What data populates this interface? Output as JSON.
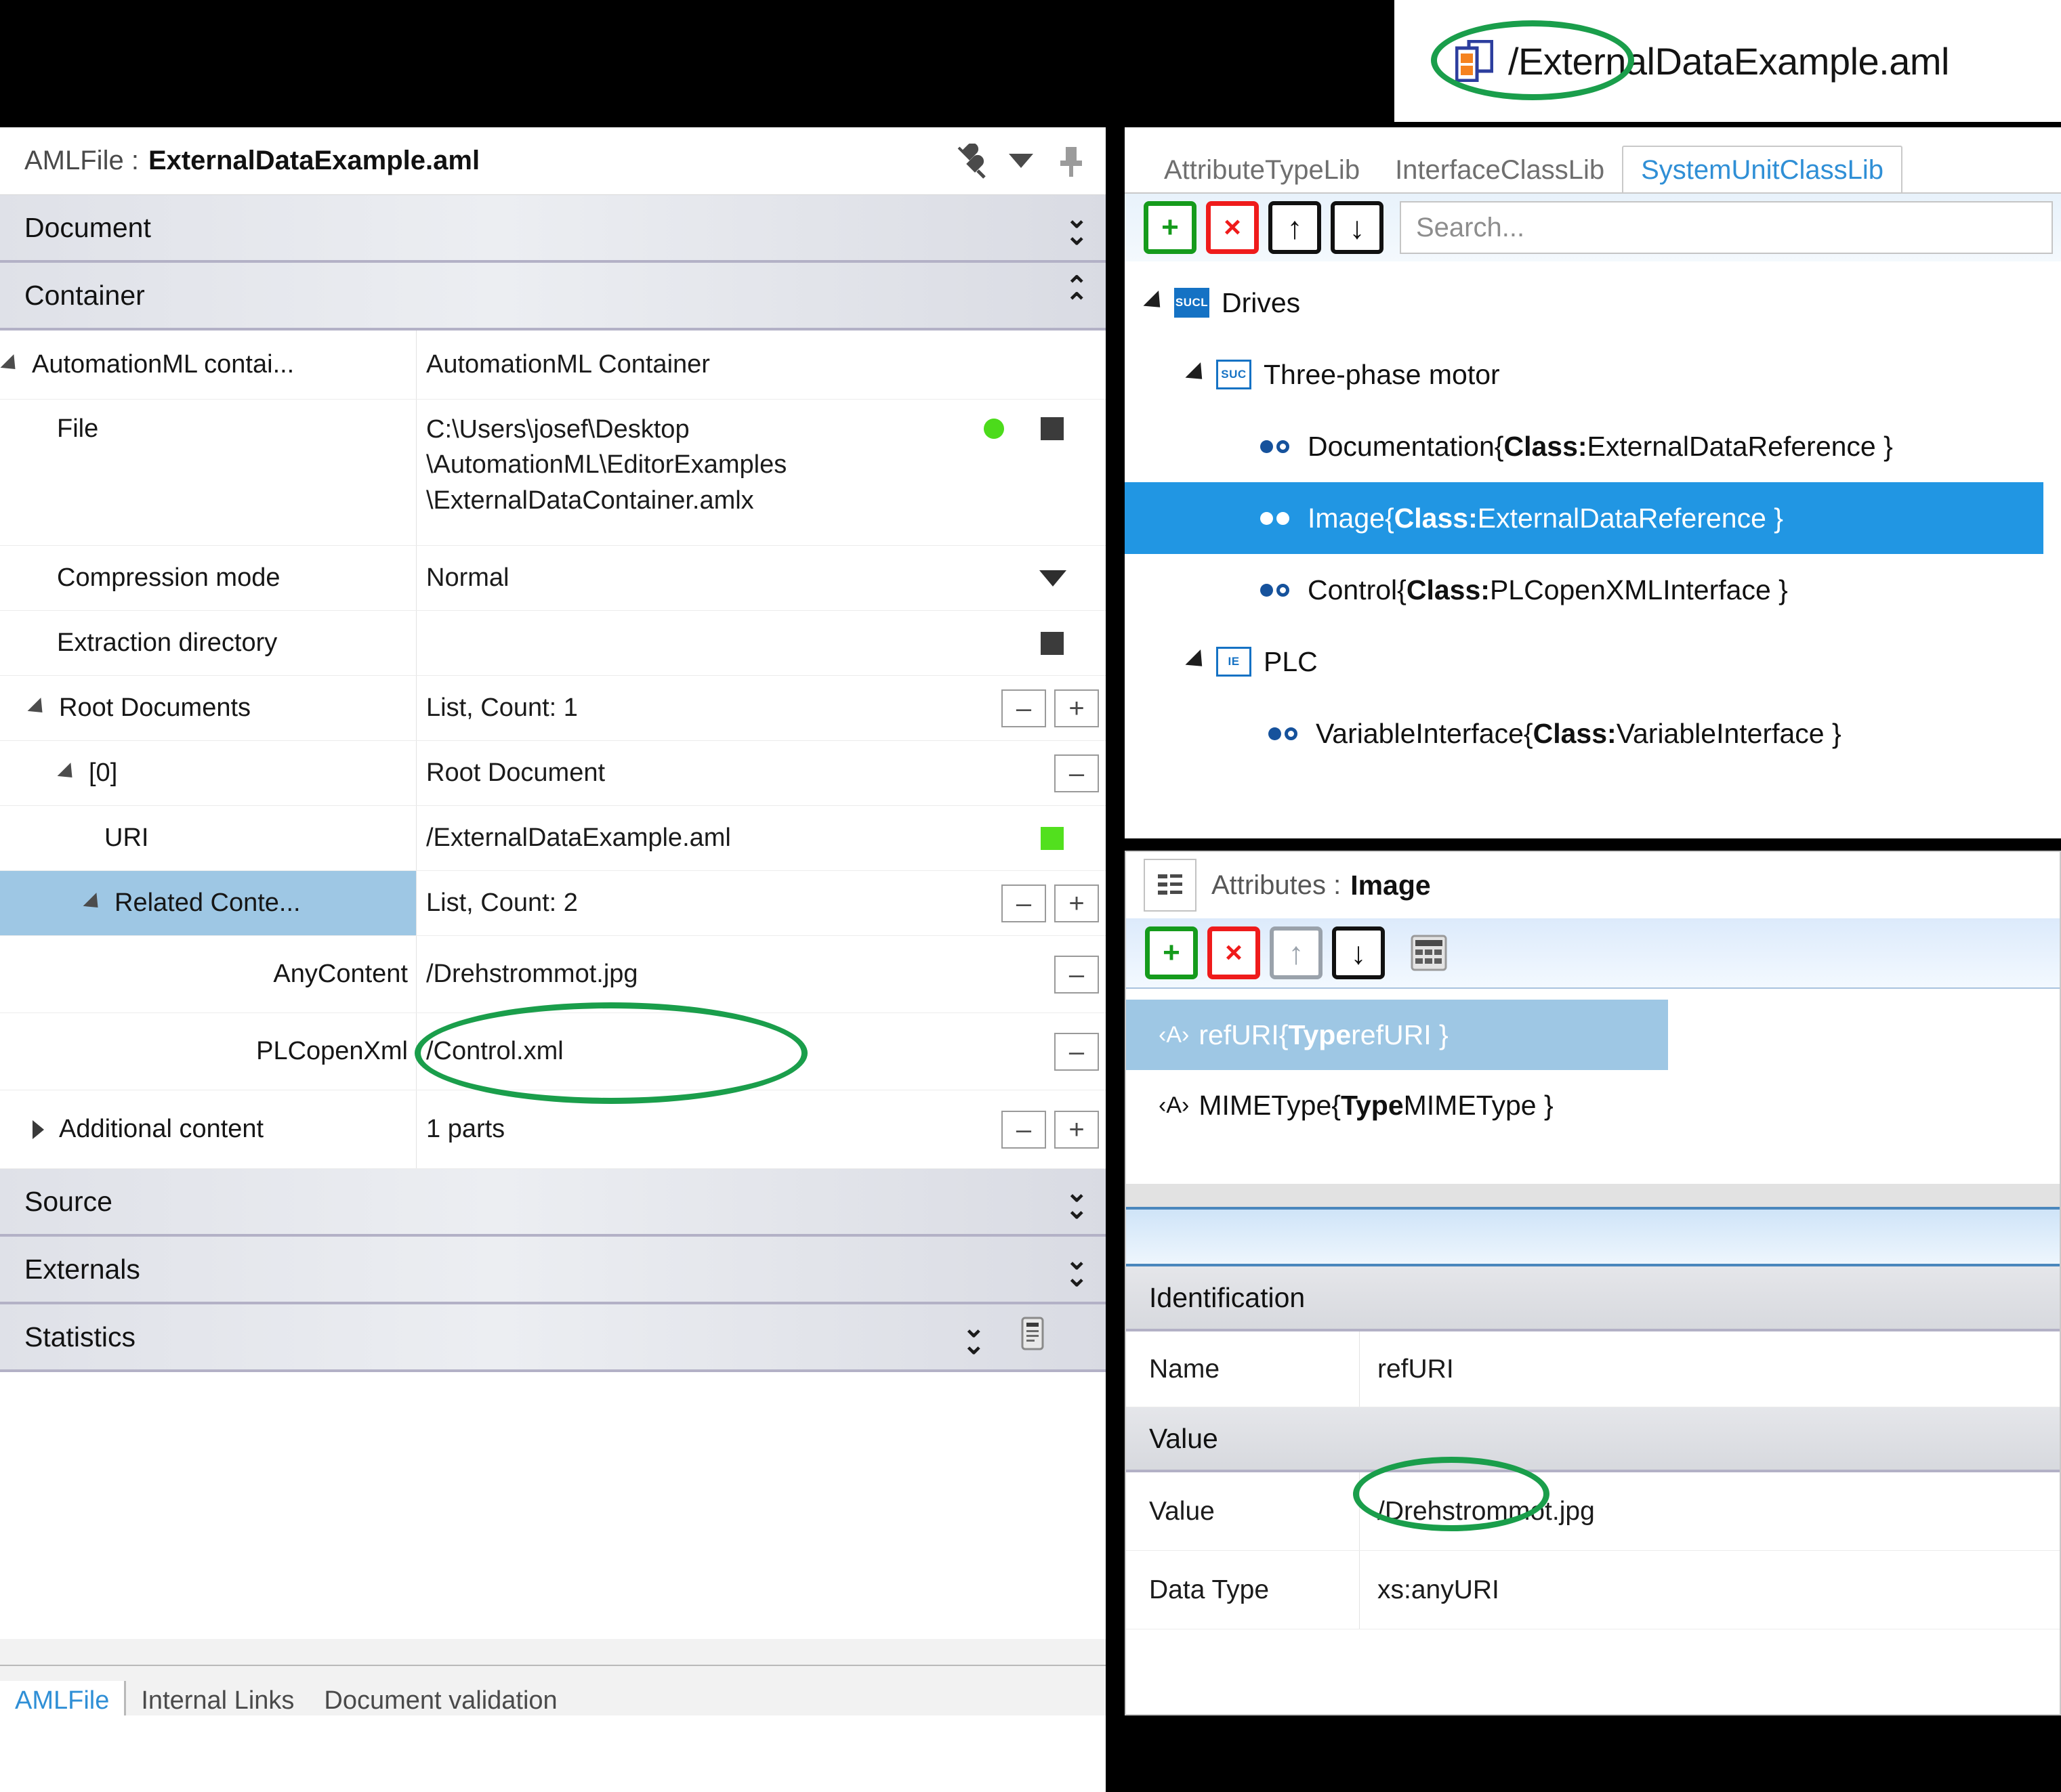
{
  "banner": {
    "icon": "container-document-icon",
    "title": "/ExternalDataExample.aml"
  },
  "left_panel": {
    "title_label": "AMLFile :",
    "title_file": "ExternalDataExample.aml",
    "titlebar_icons": [
      "disconnect-plug-icon",
      "chevron-down-icon",
      "pin-icon"
    ],
    "groups": {
      "document": "Document",
      "container": "Container",
      "source": "Source",
      "externals": "Externals",
      "statistics": "Statistics"
    },
    "rows": [
      {
        "name": "AutomationML contai...",
        "value": "AutomationML Container"
      },
      {
        "name": "File",
        "value": "C:\\Users\\josef\\Desktop\n\\AutomationML\\EditorExamples\n\\ExternalDataContainer.amlx"
      },
      {
        "name": "Compression mode",
        "value": "Normal"
      },
      {
        "name": "Extraction directory",
        "value": ""
      },
      {
        "name": "Root Documents",
        "value": "List, Count: 1"
      },
      {
        "name": "[0]",
        "value": "Root Document"
      },
      {
        "name": "URI",
        "value": "/ExternalDataExample.aml"
      },
      {
        "name": "Related Conte...",
        "value": "List, Count: 2"
      },
      {
        "name": "AnyContent",
        "value": "/Drehstrommot.jpg"
      },
      {
        "name": "PLCopenXml",
        "value": "/Control.xml"
      },
      {
        "name": "Additional content",
        "value": "1 parts"
      }
    ],
    "minus_label": "–",
    "plus_label": "+",
    "tabs": [
      {
        "label": "AMLFile",
        "active": true
      },
      {
        "label": "Internal Links",
        "active": false
      },
      {
        "label": "Document validation",
        "active": false
      }
    ]
  },
  "right_top": {
    "tabs": [
      {
        "label": "AttributeTypeLib",
        "active": false
      },
      {
        "label": "InterfaceClassLib",
        "active": false
      },
      {
        "label": "SystemUnitClassLib",
        "active": true
      }
    ],
    "toolbar": {
      "add": "+",
      "delete": "×",
      "move_up": "↑",
      "move_down": "↓"
    },
    "search_placeholder": "Search...",
    "tree": [
      {
        "label": "Drives",
        "badge": "SUCL",
        "badge_style": "solid",
        "arrow": true,
        "indent": 0,
        "selected": false
      },
      {
        "label": "Three-phase motor",
        "badge": "SUC",
        "badge_style": "hollow",
        "arrow": true,
        "indent": 1,
        "selected": false
      },
      {
        "label": "Documentation ",
        "class_key": "Class:",
        "class_val": " ExternalDataReference }",
        "brace": "{",
        "icon": "interface-dot-icon",
        "indent": 2,
        "selected": false
      },
      {
        "label": "Image ",
        "class_key": "Class:",
        "class_val": " ExternalDataReference }",
        "brace": "{",
        "icon": "interface-dot-link-icon",
        "indent": 2,
        "selected": true
      },
      {
        "label": "Control ",
        "class_key": "Class:",
        "class_val": " PLCopenXMLInterface }",
        "brace": "{",
        "icon": "interface-dot-icon",
        "indent": 2,
        "selected": false
      },
      {
        "label": "PLC",
        "badge": "IE",
        "badge_style": "hollow",
        "arrow": true,
        "indent": 1,
        "selected": false
      },
      {
        "label": "VariableInterface ",
        "class_key": "Class:",
        "class_val": " VariableInterface }",
        "brace": "{",
        "icon": "interface-dot-link-icon",
        "indent": 2,
        "selected": false
      }
    ]
  },
  "right_bottom": {
    "header_icon": "attributes-list-icon",
    "header_label": "Attributes :",
    "header_value": "Image",
    "toolbar": {
      "add": "+",
      "delete": "×",
      "move_up": "↑",
      "move_down": "↓",
      "table": "grid-icon"
    },
    "attributes": [
      {
        "abbr": "‹A›",
        "name": "refURI ",
        "brace": "{",
        "type_key": "Type",
        "type_val": " refURI }",
        "selected": true
      },
      {
        "abbr": "‹A›",
        "name": "MIMEType ",
        "brace": "{",
        "type_key": "Type",
        "type_val": " MIMEType }",
        "selected": false
      }
    ],
    "sections": [
      {
        "title": "Identification",
        "rows": [
          {
            "key": "Name",
            "value": "refURI"
          }
        ]
      },
      {
        "title": "Value",
        "rows": [
          {
            "key": "Value",
            "value": "/Drehstrommot.jpg"
          },
          {
            "key": "Data Type",
            "value": "xs:anyURI"
          }
        ]
      }
    ]
  },
  "highlights": {
    "color": "#1a9e4b",
    "targets": [
      "banner-title",
      "anycontent-value",
      "value-row-value"
    ]
  }
}
